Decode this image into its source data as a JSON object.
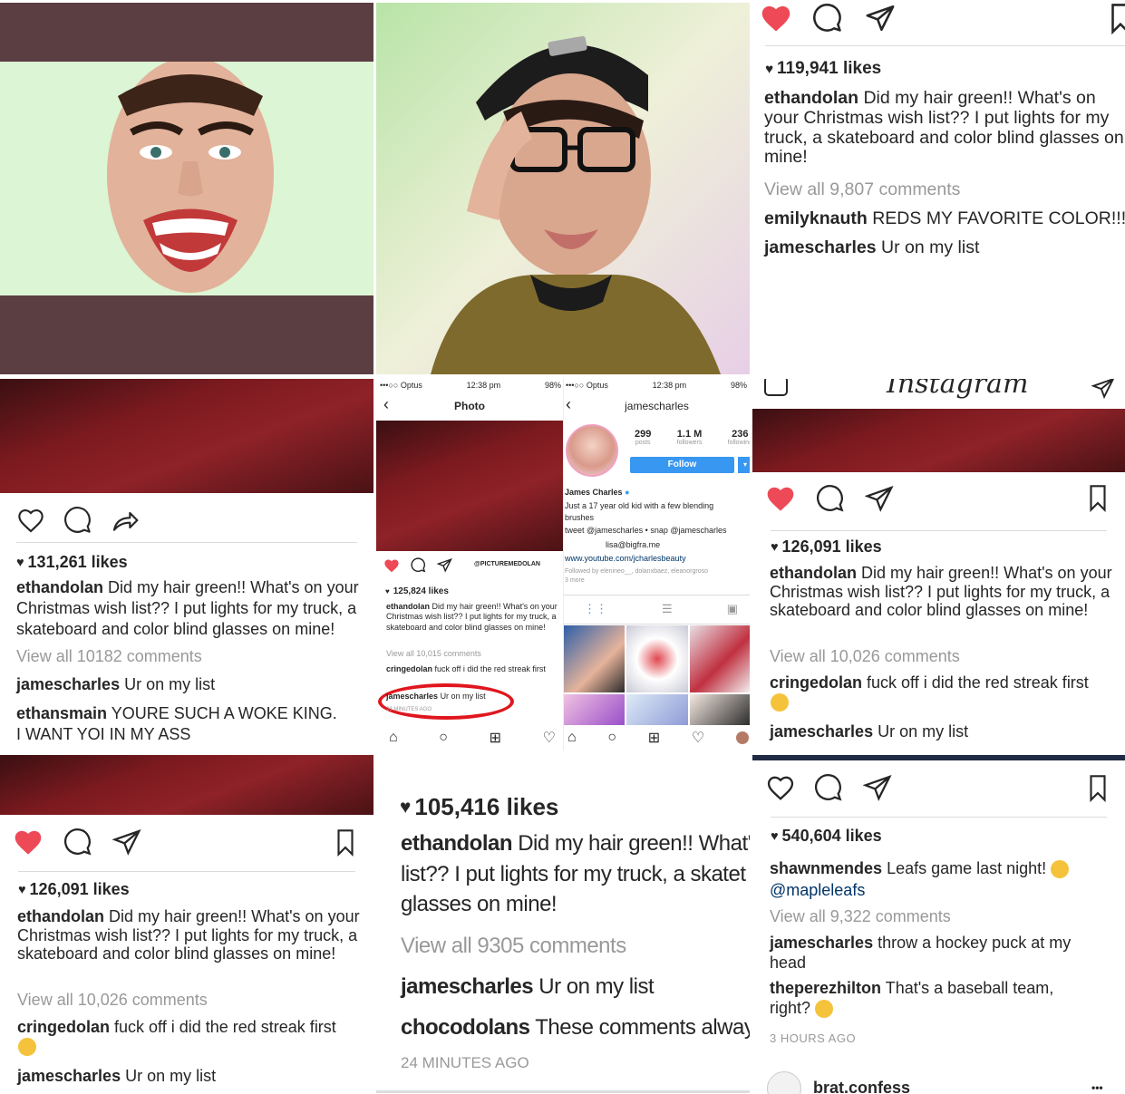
{
  "panel_top_right": {
    "likes": "119,941 likes",
    "caption_user": "ethandolan",
    "caption_text": "Did my hair green!! What's on your Christmas wish list?? I put lights for my truck, a skateboard and color blind glasses on mine!",
    "view_comments": "View all 9,807 comments",
    "comments": [
      {
        "user": "emilyknauth",
        "text": "REDS MY FAVORITE COLOR!!!!"
      },
      {
        "user": "jamescharles",
        "text": "Ur on my list"
      }
    ]
  },
  "panel_mid_left": {
    "likes": "131,261 likes",
    "caption_user": "ethandolan",
    "caption_text": "Did my hair green!! What's on your Christmas wish list?? I put lights for my truck, a skateboard and color blind glasses on mine!",
    "view_comments": "View all 10182 comments",
    "comments": [
      {
        "user": "jamescharles",
        "text": "Ur on my list"
      },
      {
        "user": "ethansmain",
        "text": "YOURE SUCH A WOKE KING. I WANT YOI IN MY ASS"
      }
    ]
  },
  "panel_mid_center": {
    "status_left": {
      "carrier": "•••○○ Optus",
      "time": "12:38 pm",
      "battery": "98%"
    },
    "status_right": {
      "carrier": "•••○○ Optus",
      "time": "12:38 pm",
      "battery": "98%"
    },
    "left_title": "Photo",
    "right_title": "jamescharles",
    "stats": [
      {
        "value": "299",
        "label": "posts"
      },
      {
        "value": "1.1 M",
        "label": "followers"
      },
      {
        "value": "236",
        "label": "following"
      }
    ],
    "follow_label": "Follow",
    "profile_name": "James Charles",
    "bio_lines": [
      "Just a 17 year old kid with a few blending",
      "brushes",
      "tweet @jamescharles • snap @jamescharles",
      "lisa@bigfra.me"
    ],
    "link": "www.youtube.com/jcharlesbeauty",
    "followed_by": "Followed by elenineo__, dolanxbaez, eleanorgroso",
    "more": "3 more",
    "watermark": "@PICTUREMEDOLAN",
    "likes": "125,824 likes",
    "caption_user": "ethandolan",
    "caption_text": "Did my hair green!! What's on your Christmas wish list?? I put lights for my truck, a skateboard and color blind glasses on mine!",
    "view_comments": "View all 10,015 comments",
    "comments": [
      {
        "user": "cringedolan",
        "text": "fuck off i did the red streak first"
      },
      {
        "user": "jamescharles",
        "text": "Ur on my list"
      }
    ],
    "time_ago": "23 MINUTES AGO"
  },
  "panel_mid_right": {
    "brand": "Instagram",
    "likes": "126,091 likes",
    "caption_user": "ethandolan",
    "caption_text": "Did my hair green!! What's on your Christmas wish list?? I put lights for my truck, a skateboard and color blind glasses on mine!",
    "view_comments": "View all 10,026 comments",
    "comments": [
      {
        "user": "cringedolan",
        "text": "fuck off i did the red streak first"
      },
      {
        "user": "jamescharles",
        "text": "Ur on my list"
      }
    ]
  },
  "panel_bot_left": {
    "likes": "126,091 likes",
    "caption_user": "ethandolan",
    "caption_text": "Did my hair green!! What's on your Christmas wish list?? I put lights for my truck, a skateboard and color blind glasses on mine!",
    "view_comments": "View all 10,026 comments",
    "comments": [
      {
        "user": "cringedolan",
        "text": "fuck off i did the red streak first"
      },
      {
        "user": "jamescharles",
        "text": "Ur on my list"
      }
    ]
  },
  "panel_bot_center": {
    "likes": "105,416 likes",
    "caption_user": "ethandolan",
    "caption_line1": "Did my hair green!! What's",
    "caption_line2": "list?? I put lights for my truck, a skatet",
    "caption_line3": "glasses on mine!",
    "view_comments": "View all 9305 comments",
    "comments": [
      {
        "user": "jamescharles",
        "text": "Ur on my list"
      },
      {
        "user": "chocodolans",
        "text": "These comments alway:"
      }
    ],
    "time_ago": "24 MINUTES AGO"
  },
  "panel_bot_right": {
    "likes": "540,604 likes",
    "caption_user": "shawnmendes",
    "caption_text": "Leafs game last night!",
    "caption_mention": "@mapleleafs",
    "view_comments": "View all 9,322 comments",
    "comments": [
      {
        "user": "jamescharles",
        "text": "throw a hockey puck at my head"
      },
      {
        "user": "theperezhilton",
        "text": "That's a baseball team, right?"
      }
    ],
    "time_ago": "3 HOURS AGO",
    "next_user": "brat.confess",
    "more_glyph": "•••"
  },
  "colors": {
    "like_red": "#ed4956",
    "link_blue": "#003569",
    "follow_blue": "#3897f0",
    "grey_text": "#999999",
    "sweater_red": "#7c1a1f",
    "bar_maroon": "#5a3e42"
  }
}
